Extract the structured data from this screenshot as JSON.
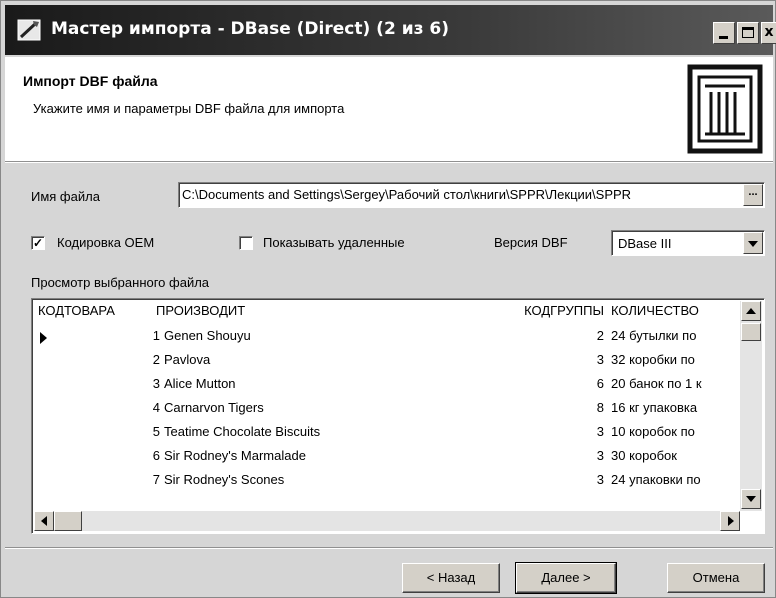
{
  "window": {
    "title": "Мастер импорта - DBase (Direct) (2 из 6)"
  },
  "header": {
    "title": "Импорт DBF файла",
    "subtitle": "Укажите имя и параметры DBF файла для импорта"
  },
  "form": {
    "filename_label": "Имя файла",
    "filename_value": "C:\\Documents and Settings\\Sergey\\Рабочий стол\\книги\\SPPR\\Лекции\\SPPR",
    "browse_label": "...",
    "oem_label": "Кодировка OEM",
    "oem_checked": true,
    "show_deleted_label": "Показывать удаленные",
    "show_deleted_checked": false,
    "version_label": "Версия DBF",
    "version_value": "DBase III"
  },
  "preview": {
    "label": "Просмотр выбранного файла",
    "columns": [
      "КОДТОВАРА",
      "ПРОИЗВОДИТ",
      "КОДГРУППЫ",
      "КОЛИЧЕСТВО"
    ],
    "rows": [
      [
        "1",
        "Genen Shouyu",
        "2",
        "24 бутылки по"
      ],
      [
        "2",
        "Pavlova",
        "3",
        "32 коробки по"
      ],
      [
        "3",
        "Alice Mutton",
        "6",
        "20 банок по 1 к"
      ],
      [
        "4",
        "Carnarvon Tigers",
        "8",
        "16 кг упаковка"
      ],
      [
        "5",
        "Teatime Chocolate Biscuits",
        "3",
        "10 коробок по"
      ],
      [
        "6",
        "Sir Rodney's Marmalade",
        "3",
        "30 коробок"
      ],
      [
        "7",
        "Sir Rodney's Scones",
        "3",
        "24 упаковки по"
      ]
    ],
    "current_row": 0
  },
  "buttons": {
    "back": "< Назад",
    "next": "Далее >",
    "cancel": "Отмена"
  },
  "titlebar_buttons": {
    "close": "x"
  }
}
